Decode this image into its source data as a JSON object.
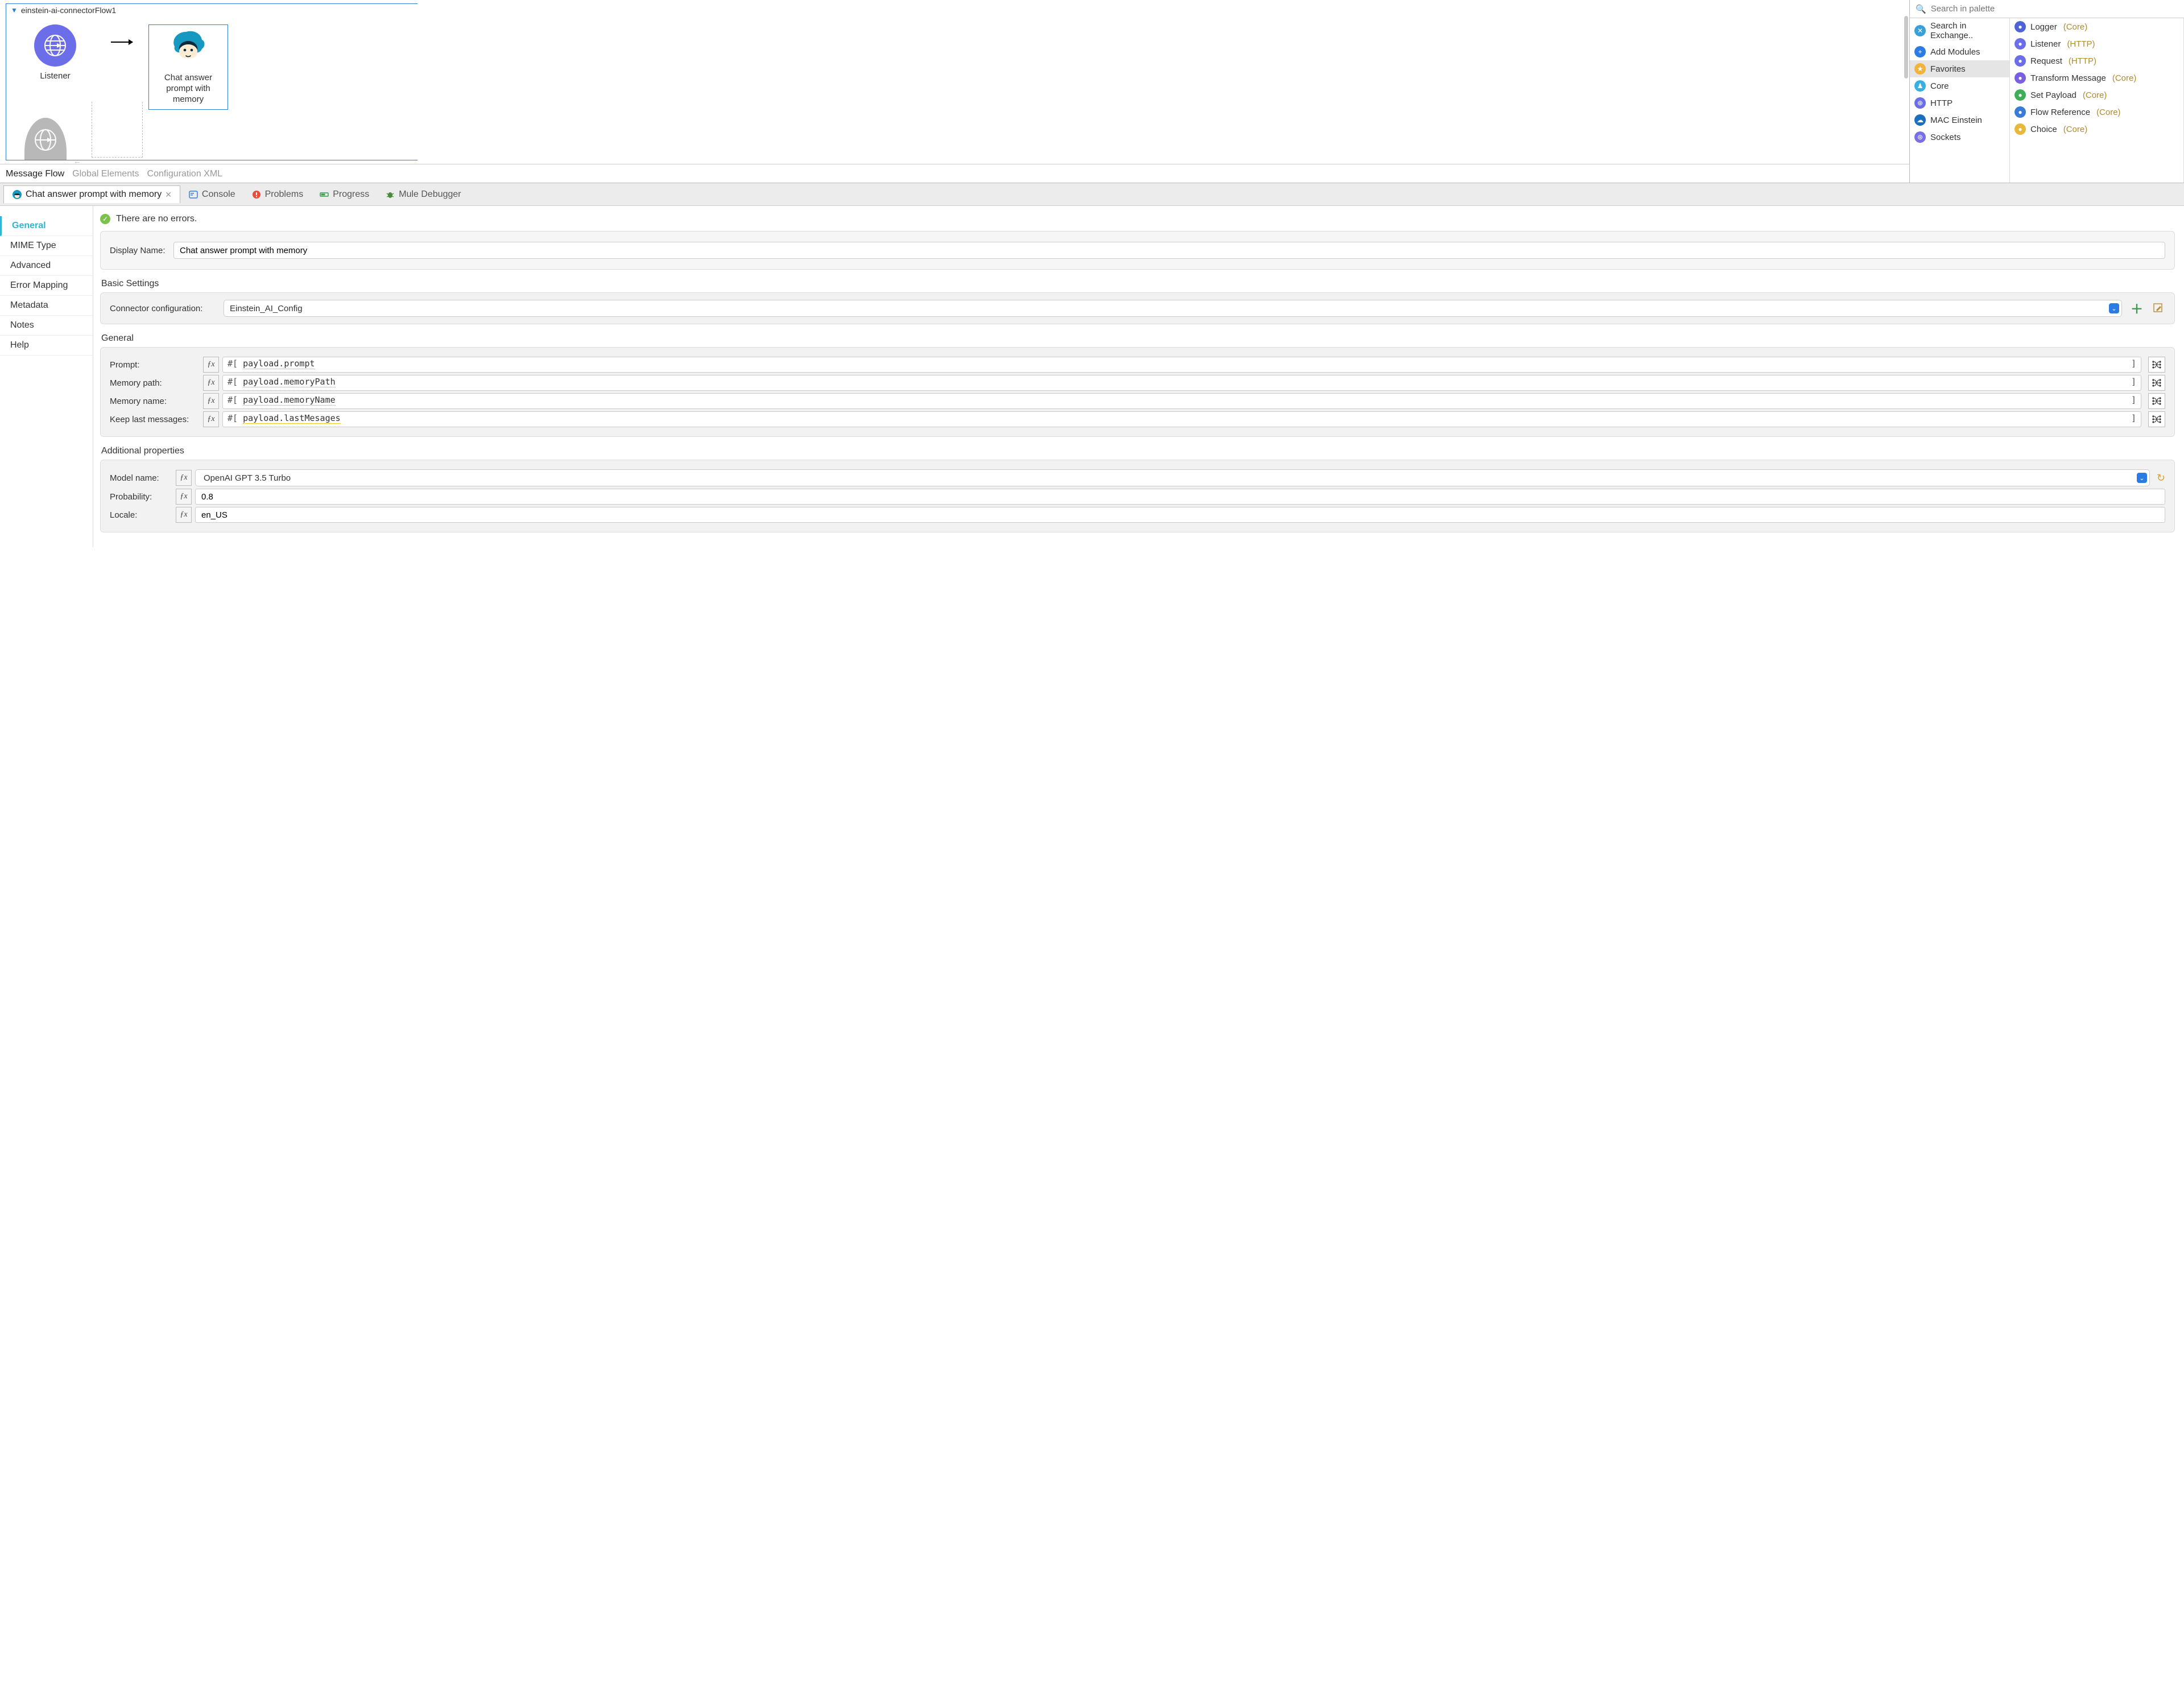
{
  "flow": {
    "name": "einstein-ai-connectorFlow1",
    "listener_label": "Listener",
    "chat_label": "Chat answer\nprompt with\nmemory"
  },
  "canvas_tabs": [
    "Message Flow",
    "Global Elements",
    "Configuration XML"
  ],
  "palette": {
    "search_placeholder": "Search in palette",
    "left": [
      {
        "label": "Search in Exchange..",
        "color": "#3aa0d8",
        "glyph": "✕"
      },
      {
        "label": "Add Modules",
        "color": "#2a7be4",
        "glyph": "+"
      },
      {
        "label": "Favorites",
        "color": "#f0b43a",
        "glyph": "★",
        "selected": true
      },
      {
        "label": "Core",
        "color": "#35b0e0",
        "glyph": "♟"
      },
      {
        "label": "HTTP",
        "color": "#6b6ee8",
        "glyph": "⊕"
      },
      {
        "label": "MAC Einstein",
        "color": "#1a6fc0",
        "glyph": "☁"
      },
      {
        "label": "Sockets",
        "color": "#7a6ee8",
        "glyph": "⊛"
      }
    ],
    "right": [
      {
        "label": "Logger",
        "suffix": "(Core)",
        "color": "#4d63d6"
      },
      {
        "label": "Listener",
        "suffix": "(HTTP)",
        "color": "#6b6ee8"
      },
      {
        "label": "Request",
        "suffix": "(HTTP)",
        "color": "#6b6ee8"
      },
      {
        "label": "Transform Message",
        "suffix": "(Core)",
        "color": "#7a5fe0"
      },
      {
        "label": "Set Payload",
        "suffix": "(Core)",
        "color": "#3fae58"
      },
      {
        "label": "Flow Reference",
        "suffix": "(Core)",
        "color": "#3a7bd6"
      },
      {
        "label": "Choice",
        "suffix": "(Core)",
        "color": "#e8b83a"
      }
    ]
  },
  "bottom_tabs": {
    "active": "Chat answer prompt with memory",
    "others": [
      "Console",
      "Problems",
      "Progress",
      "Mule Debugger"
    ]
  },
  "status_text": "There are no errors.",
  "side_tabs": [
    "General",
    "MIME Type",
    "Advanced",
    "Error Mapping",
    "Metadata",
    "Notes",
    "Help"
  ],
  "display_name": {
    "label": "Display Name:",
    "value": "Chat answer prompt with memory"
  },
  "basic": {
    "title": "Basic Settings",
    "cfg_label": "Connector configuration:",
    "cfg_value": "Einstein_AI_Config"
  },
  "general": {
    "title": "General",
    "rows": [
      {
        "label": "Prompt:",
        "expr_pre": "#[ ",
        "expr": "payload.prompt",
        "expr_post": "]"
      },
      {
        "label": "Memory path:",
        "expr_pre": "#[ ",
        "expr": "payload.memoryPath",
        "expr_post": "]"
      },
      {
        "label": "Memory name:",
        "expr_pre": "#[ ",
        "expr": "payload.memoryName",
        "expr_post": "]"
      },
      {
        "label": "Keep last messages:",
        "expr_pre": "#[ ",
        "expr": "payload.lastMesages",
        "expr_post": "]"
      }
    ]
  },
  "additional": {
    "title": "Additional properties",
    "model_label": "Model name:",
    "model_value": "OpenAI GPT 3.5 Turbo",
    "prob_label": "Probability:",
    "prob_value": "0.8",
    "locale_label": "Locale:",
    "locale_value": "en_US"
  }
}
